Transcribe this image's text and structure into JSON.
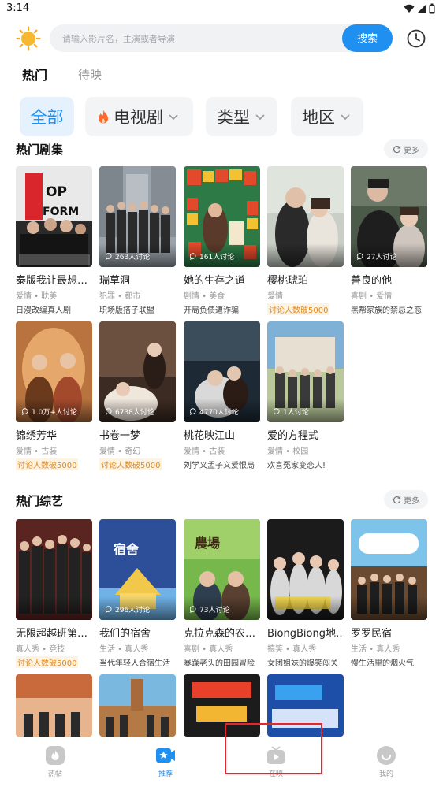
{
  "status": {
    "time": "3:14"
  },
  "search": {
    "placeholder": "请输入影片名，主演或者导演",
    "button": "搜索"
  },
  "tabs": [
    {
      "label": "热门",
      "active": true
    },
    {
      "label": "待映",
      "active": false
    }
  ],
  "filters": {
    "all": "全部",
    "tv": "电视剧",
    "type": "类型",
    "region": "地区"
  },
  "colors": {
    "accent": "#1f8ff0",
    "badge": "#e08a1e",
    "highlight": "#e5262b"
  },
  "sections": {
    "drama": {
      "title": "热门剧集",
      "more": "更多",
      "items": [
        {
          "title": "泰版我让最想…",
          "genre": "爱情 • 耽美",
          "desc": "日漫改编真人剧"
        },
        {
          "title": "瑞草洞",
          "genre": "犯罪 • 都市",
          "desc": "职场版搭子联盟",
          "discuss": "263人讨论"
        },
        {
          "title": "她的生存之道",
          "genre": "剧情 • 美食",
          "desc": "开局负债遭诈骗",
          "discuss": "161人讨论"
        },
        {
          "title": "樱桃琥珀",
          "genre": "爱情",
          "badge": "讨论人数破5000"
        },
        {
          "title": "善良的他",
          "genre": "喜剧 • 爱情",
          "desc": "黑帮家族的禁忌之恋",
          "discuss": "27人讨论"
        },
        {
          "title": "锦绣芳华",
          "genre": "爱情 • 古装",
          "badge": "讨论人数破5000",
          "discuss": "1.0万+人讨论"
        },
        {
          "title": "书卷一梦",
          "genre": "爱情 • 奇幻",
          "badge": "讨论人数破5000",
          "discuss": "6738人讨论"
        },
        {
          "title": "桃花映江山",
          "genre": "爱情 • 古装",
          "desc": "刘学义孟子义爱恨局",
          "discuss": "4770人讨论"
        },
        {
          "title": "爱的方程式",
          "genre": "爱情 • 校园",
          "desc": "欢喜冤家变恋人!",
          "discuss": "1人讨论"
        }
      ]
    },
    "variety": {
      "title": "热门综艺",
      "more": "更多",
      "items": [
        {
          "title": "无限超越班第…",
          "genre": "真人秀 • 竞技",
          "badge": "讨论人数破5000"
        },
        {
          "title": "我们的宿舍",
          "genre": "生活 • 真人秀",
          "desc": "当代年轻人合宿生活",
          "discuss": "296人讨论"
        },
        {
          "title": "克拉克森的农…",
          "genre": "喜剧 • 真人秀",
          "desc": "暴躁老头的田园冒险",
          "discuss": "73人讨论"
        },
        {
          "title": "BiongBiong地…",
          "genre": "搞笑 • 真人秀",
          "desc": "女团姐妹的爆笑闯关"
        },
        {
          "title": "罗罗民宿",
          "genre": "生活 • 真人秀",
          "desc": "慢生活里的烟火气"
        }
      ]
    }
  },
  "nav": [
    {
      "label": "热帖",
      "icon": "house-icon"
    },
    {
      "label": "推荐",
      "icon": "star-ticket-icon",
      "active": true
    },
    {
      "label": "在映",
      "icon": "tv-icon"
    },
    {
      "label": "我的",
      "icon": "face-icon"
    }
  ]
}
